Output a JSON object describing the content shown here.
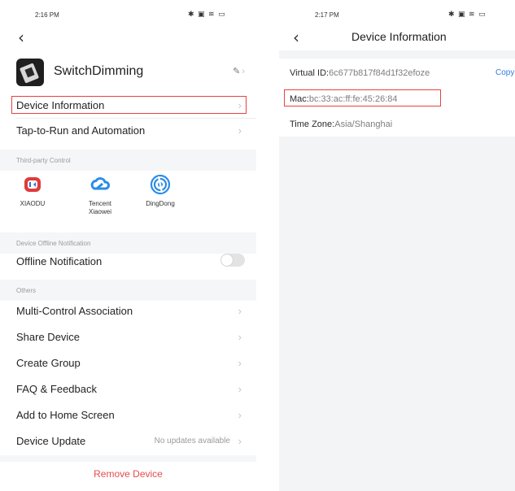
{
  "left": {
    "status_time": "2:16 PM",
    "status_icons": "✱ ▣ ≋ ▭",
    "device_name": "SwitchDimming",
    "edit_icon": "pencil-icon",
    "menu": {
      "device_information": "Device Information",
      "tap_to_run": "Tap-to-Run and Automation"
    },
    "sections": {
      "third_party": "Third-party Control",
      "offline": "Device Offline Notification",
      "others": "Others"
    },
    "third_party": [
      {
        "label": "XIAODU",
        "color": "#e03a3a"
      },
      {
        "label": "Tencent\nXiaowei",
        "color": "#2b8ce6"
      },
      {
        "label": "DingDong",
        "color": "#2b8ce6"
      }
    ],
    "offline_notification": {
      "label": "Offline Notification",
      "enabled": false
    },
    "others": {
      "multi_control": "Multi-Control Association",
      "share_device": "Share Device",
      "create_group": "Create Group",
      "faq": "FAQ & Feedback",
      "add_home": "Add to Home Screen",
      "device_update": "Device Update",
      "device_update_value": "No updates available"
    },
    "remove_device": "Remove Device"
  },
  "right": {
    "status_time": "2:17 PM",
    "status_icons": "✱ ▣ ≋ ▭",
    "title": "Device Information",
    "virtual_id_key": "Virtual ID:",
    "virtual_id_value": "6c677b817f84d1f32efoze",
    "copy_label": "Copy",
    "mac_key": "Mac:",
    "mac_value": "bc:33:ac:ff:fe:45:26:84",
    "timezone_key": "Time Zone:",
    "timezone_value": "Asia/Shanghai"
  },
  "colors": {
    "highlight": "#e5423f",
    "accent": "#2f7ee0",
    "danger": "#e54c4c",
    "section_bg": "#f5f6f7"
  }
}
